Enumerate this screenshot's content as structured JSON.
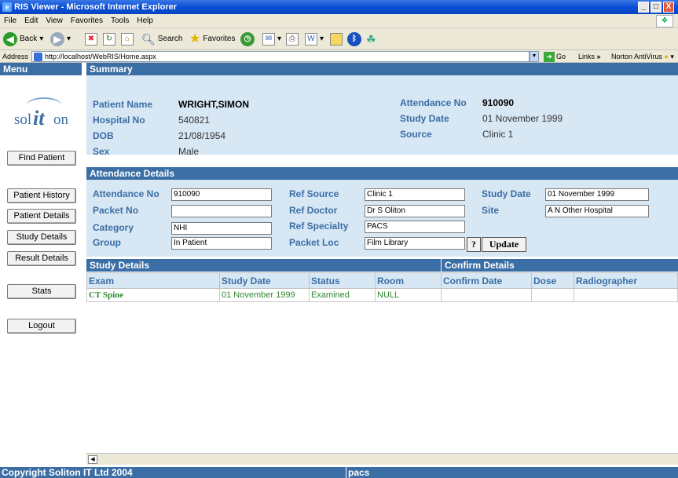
{
  "window": {
    "title": "RIS Viewer - Microsoft Internet Explorer",
    "controls": [
      "_",
      "□",
      "X"
    ]
  },
  "menubar": [
    "File",
    "Edit",
    "View",
    "Favorites",
    "Tools",
    "Help"
  ],
  "toolbar": {
    "back": "Back",
    "search": "Search",
    "favorites": "Favorites"
  },
  "addressbar": {
    "label": "Address",
    "url": "http://localhost/WebRIS/Home.aspx",
    "go": "Go",
    "links": "Links",
    "links_chevron": "»",
    "norton": "Norton AntiVirus"
  },
  "menu_title": "Menu",
  "logo": {
    "sol": "sol",
    "it": "it",
    "on": "on"
  },
  "sidebar": {
    "find_patient": "Find Patient",
    "buttons": [
      "Patient History",
      "Patient Details",
      "Study Details",
      "Result Details"
    ],
    "stats": "Stats",
    "logout": "Logout"
  },
  "summary": {
    "title": "Summary",
    "patient_name_label": "Patient Name",
    "patient_name": "WRIGHT,SIMON",
    "hospital_no_label": "Hospital No",
    "hospital_no": "540821",
    "dob_label": "DOB",
    "dob": "21/08/1954",
    "sex_label": "Sex",
    "sex": "Male",
    "attendance_no_label": "Attendance No",
    "attendance_no": "910090",
    "study_date_label": "Study Date",
    "study_date": "01 November 1999",
    "source_label": "Source",
    "source": "Clinic 1"
  },
  "attendance": {
    "title": "Attendance Details",
    "attendance_no_label": "Attendance No",
    "attendance_no": "910090",
    "packet_no_label": "Packet No",
    "packet_no": "",
    "category_label": "Category",
    "category": "NHI",
    "group_label": "Group",
    "group": "In Patient",
    "ref_source_label": "Ref Source",
    "ref_source": "Clinic 1",
    "ref_doctor_label": "Ref Doctor",
    "ref_doctor": "Dr S Oliton",
    "ref_specialty_label": "Ref Specialty",
    "ref_specialty": "PACS",
    "packet_loc_label": "Packet Loc",
    "packet_loc": "Film Library",
    "study_date_label": "Study Date",
    "study_date": "01 November 1999",
    "site_label": "Site",
    "site": "A N Other Hospital",
    "help_button": "?",
    "update_button": "Update"
  },
  "study": {
    "title": "Study Details",
    "confirm_title": "Confirm Details",
    "columns": [
      "Exam",
      "Study Date",
      "Status",
      "Room",
      "Confirm Date",
      "Dose",
      "Radiographer"
    ],
    "rows": [
      [
        "CT Spine",
        "01 November 1999",
        "Examined",
        "NULL",
        "",
        "",
        ""
      ]
    ]
  },
  "footer": {
    "copyright": "Copyright Soliton IT Ltd 2004",
    "user": "pacs"
  }
}
